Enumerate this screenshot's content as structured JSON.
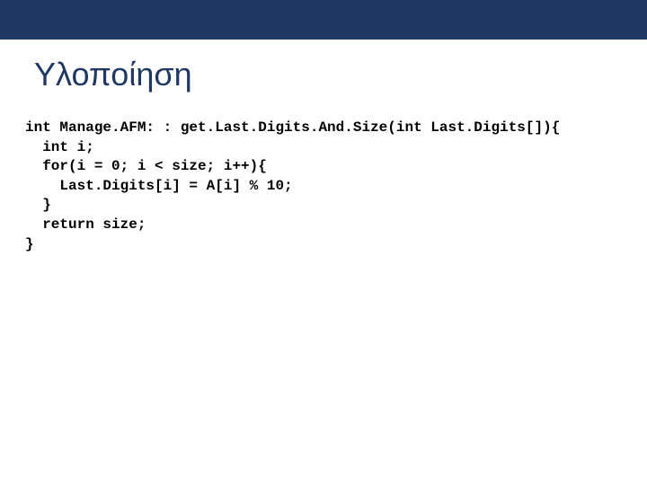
{
  "header": {
    "title": "Υλοποίηση"
  },
  "code": {
    "line1": "int Manage.AFM: : get.Last.Digits.And.Size(int Last.Digits[]){",
    "line2": "  int i;",
    "line3": "  for(i = 0; i < size; i++){",
    "line4": "    Last.Digits[i] = A[i] % 10;",
    "line5": "  }",
    "line6": "  return size;",
    "line7": "}"
  }
}
